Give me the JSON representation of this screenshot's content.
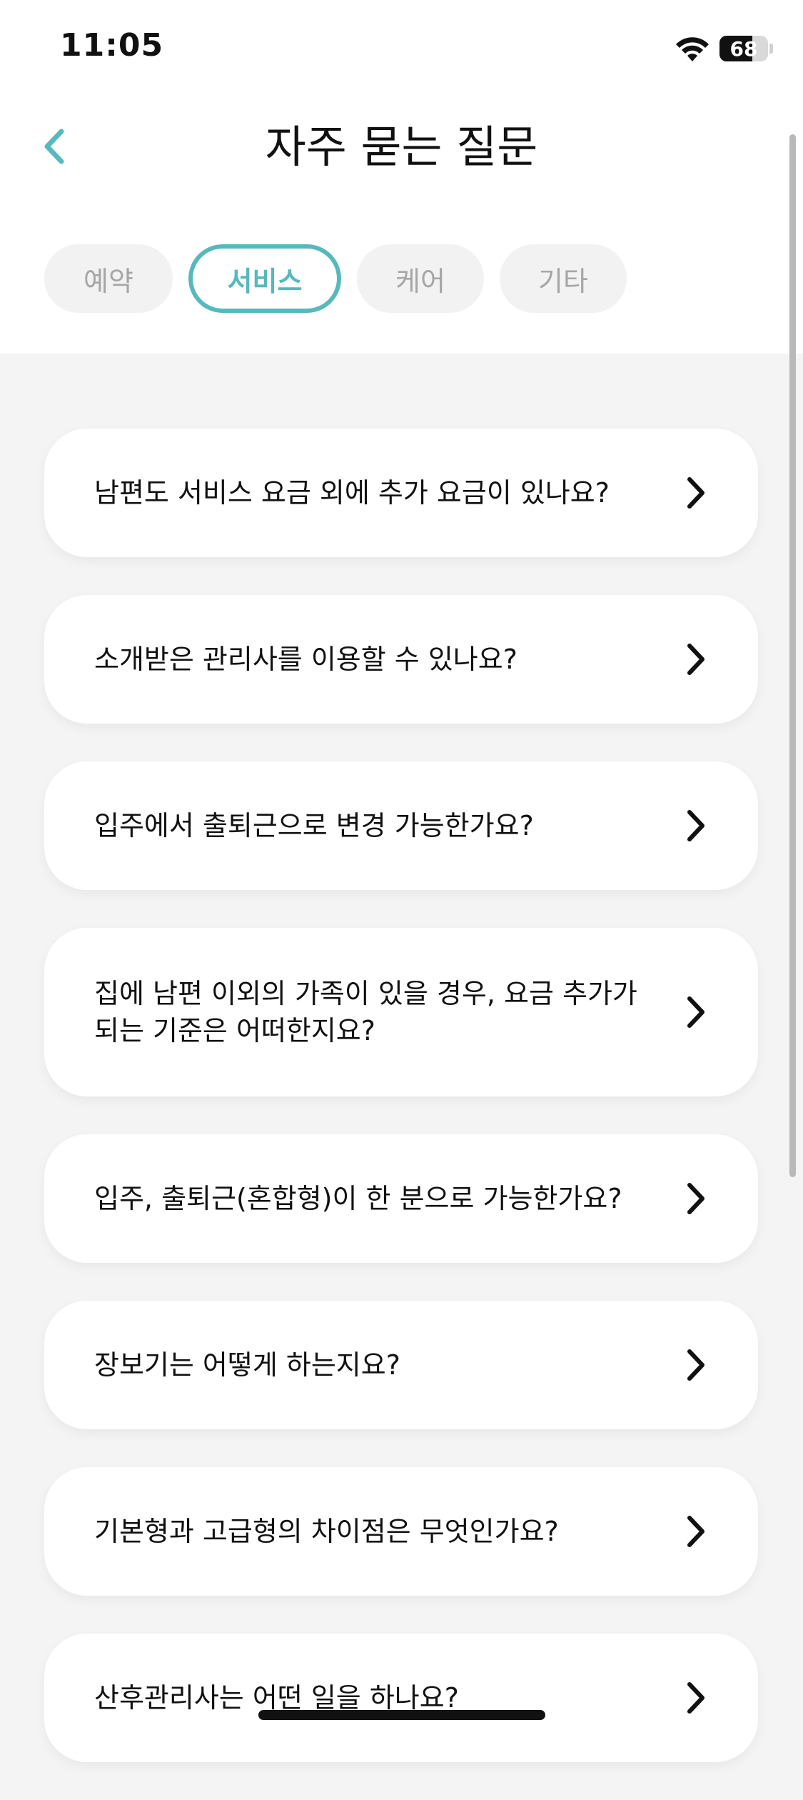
{
  "status_bar": {
    "time": "11:05",
    "battery": "68",
    "battery_level": 0.68
  },
  "header": {
    "title": "자주 묻는 질문",
    "back_icon": "chevron-left-icon"
  },
  "tabs": [
    {
      "label": "예약",
      "active": false
    },
    {
      "label": "서비스",
      "active": true
    },
    {
      "label": "케어",
      "active": false
    },
    {
      "label": "기타",
      "active": false
    }
  ],
  "faq": [
    {
      "question": "남편도 서비스 요금 외에 추가 요금이 있나요?"
    },
    {
      "question": "소개받은 관리사를 이용할 수 있나요?"
    },
    {
      "question": "입주에서 출퇴근으로 변경 가능한가요?"
    },
    {
      "question": "집에 남편 이외의 가족이 있을 경우, 요금 추가가 되는 기준은 어떠한지요?"
    },
    {
      "question": "입주, 출퇴근(혼합형)이 한 분으로 가능한가요?"
    },
    {
      "question": "장보기는 어떻게 하는지요?"
    },
    {
      "question": "기본형과 고급형의 차이점은 무엇인가요?"
    },
    {
      "question": "산후관리사는 어떤 일을 하나요?"
    }
  ],
  "colors": {
    "accent": "#57b9bb",
    "background": "#f4f4f4",
    "card": "#ffffff",
    "tab_inactive_bg": "#f2f2f2",
    "tab_inactive_text": "#a6a6a6"
  }
}
